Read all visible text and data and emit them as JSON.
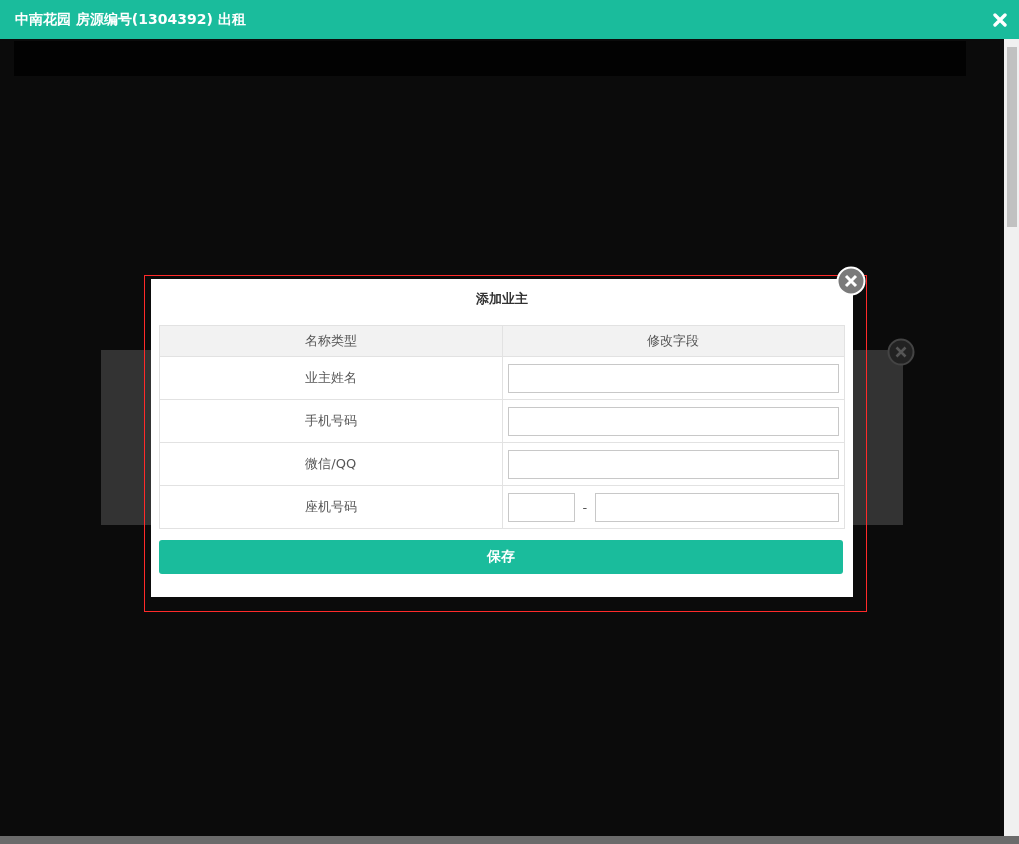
{
  "window": {
    "title": "中南花园 房源编号(1304392) 出租"
  },
  "dialog": {
    "title": "添加业主",
    "columns": [
      "名称类型",
      "修改字段"
    ],
    "rows": [
      {
        "label": "业主姓名",
        "kind": "text"
      },
      {
        "label": "手机号码",
        "kind": "text"
      },
      {
        "label": "微信/QQ",
        "kind": "text"
      },
      {
        "label": "座机号码",
        "kind": "phone",
        "separator": "-"
      }
    ],
    "save_button": "保存"
  }
}
